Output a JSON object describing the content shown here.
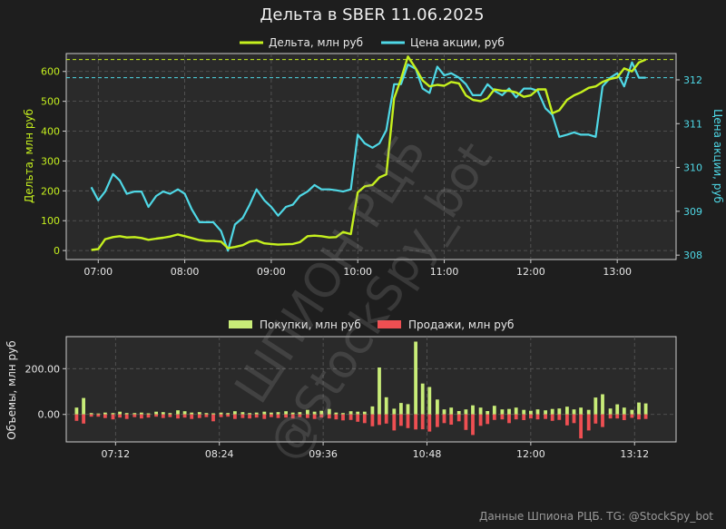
{
  "title": "Дельта в SBER 11.06.2025",
  "footer": "Данные Шпиона РЦБ. TG: @StockSpy_bot",
  "watermark": {
    "line1": "ШПИОН РЦБ",
    "line2": "@StockSpy_bot"
  },
  "colors": {
    "background": "#1e1e1e",
    "plot_bg": "#2a2a2a",
    "frame": "#cccccc",
    "delta": "#c5f01e",
    "price": "#4fd8e6",
    "buy": "#c8ec78",
    "sell": "#ee4f52",
    "text": "#e8e8e8",
    "footer": "#9a9a9a"
  },
  "chart_data": [
    {
      "type": "line",
      "legend": [
        "Дельта, млн руб",
        "Цена акции, руб"
      ],
      "legend_position": "top-center",
      "ylabel_left": "Дельта, млн руб",
      "ylabel_right": "Цена акции, руб",
      "grid": true,
      "x_unit": "hours",
      "xlim": [
        6.63,
        13.68
      ],
      "x_ticks": [
        7,
        8,
        9,
        10,
        11,
        12,
        13
      ],
      "x_tick_labels": [
        "07:00",
        "08:00",
        "09:00",
        "10:00",
        "11:00",
        "12:00",
        "13:00"
      ],
      "ylim_left": [
        -30,
        660
      ],
      "y_ticks_left": [
        0,
        100,
        200,
        300,
        400,
        500,
        600
      ],
      "ylim_right": [
        307.9,
        312.6
      ],
      "y_ticks_right": [
        308,
        309,
        310,
        311,
        312
      ],
      "ref_line_delta": 640,
      "ref_line_price": 312.05,
      "series": [
        {
          "name": "Дельта, млн руб",
          "axis": "left",
          "x": [
            6.92,
            7.0,
            7.08,
            7.17,
            7.25,
            7.33,
            7.42,
            7.5,
            7.58,
            7.67,
            7.75,
            7.83,
            7.92,
            8.0,
            8.08,
            8.17,
            8.25,
            8.33,
            8.42,
            8.5,
            8.58,
            8.67,
            8.75,
            8.83,
            8.92,
            9.0,
            9.08,
            9.17,
            9.25,
            9.33,
            9.42,
            9.5,
            9.58,
            9.67,
            9.75,
            9.83,
            9.92,
            10.0,
            10.08,
            10.17,
            10.25,
            10.33,
            10.42,
            10.5,
            10.58,
            10.67,
            10.75,
            10.83,
            10.92,
            11.0,
            11.08,
            11.17,
            11.25,
            11.33,
            11.42,
            11.5,
            11.58,
            11.67,
            11.75,
            11.83,
            11.92,
            12.0,
            12.08,
            12.17,
            12.25,
            12.33,
            12.42,
            12.5,
            12.58,
            12.67,
            12.75,
            12.83,
            12.92,
            13.0,
            13.08,
            13.17,
            13.25,
            13.33
          ],
          "y": [
            2,
            5,
            38,
            45,
            48,
            44,
            45,
            42,
            36,
            40,
            43,
            47,
            54,
            48,
            42,
            35,
            32,
            32,
            30,
            8,
            12,
            18,
            30,
            34,
            24,
            22,
            20,
            21,
            22,
            28,
            48,
            50,
            48,
            44,
            45,
            62,
            55,
            195,
            215,
            220,
            245,
            255,
            510,
            575,
            650,
            610,
            570,
            550,
            555,
            552,
            565,
            560,
            520,
            505,
            500,
            510,
            540,
            535,
            535,
            530,
            515,
            520,
            540,
            540,
            460,
            470,
            505,
            520,
            530,
            545,
            550,
            565,
            575,
            580,
            610,
            600,
            630,
            640
          ]
        },
        {
          "name": "Цена акции, руб",
          "axis": "right",
          "x": [
            6.92,
            7.0,
            7.08,
            7.17,
            7.25,
            7.33,
            7.42,
            7.5,
            7.58,
            7.67,
            7.75,
            7.83,
            7.92,
            8.0,
            8.08,
            8.17,
            8.25,
            8.33,
            8.42,
            8.5,
            8.58,
            8.67,
            8.75,
            8.83,
            8.92,
            9.0,
            9.08,
            9.17,
            9.25,
            9.33,
            9.42,
            9.5,
            9.58,
            9.67,
            9.75,
            9.83,
            9.92,
            10.0,
            10.08,
            10.17,
            10.25,
            10.33,
            10.42,
            10.5,
            10.58,
            10.67,
            10.75,
            10.83,
            10.92,
            11.0,
            11.08,
            11.17,
            11.25,
            11.33,
            11.42,
            11.5,
            11.58,
            11.67,
            11.75,
            11.83,
            11.92,
            12.0,
            12.08,
            12.17,
            12.25,
            12.33,
            12.42,
            12.5,
            12.58,
            12.67,
            12.75,
            12.83,
            12.92,
            13.0,
            13.08,
            13.17,
            13.25,
            13.33
          ],
          "y": [
            309.55,
            309.25,
            309.45,
            309.85,
            309.7,
            309.4,
            309.45,
            309.45,
            309.1,
            309.35,
            309.45,
            309.4,
            309.5,
            309.4,
            309.05,
            308.75,
            308.75,
            308.75,
            308.55,
            308.1,
            308.7,
            308.85,
            309.15,
            309.5,
            309.25,
            309.1,
            308.9,
            309.1,
            309.15,
            309.35,
            309.45,
            309.6,
            309.5,
            309.5,
            309.48,
            309.45,
            309.5,
            310.75,
            310.55,
            310.45,
            310.55,
            310.85,
            311.9,
            311.9,
            312.35,
            312.25,
            311.8,
            311.7,
            312.3,
            312.1,
            312.15,
            312.05,
            311.9,
            311.65,
            311.65,
            311.9,
            311.75,
            311.65,
            311.8,
            311.6,
            311.8,
            311.8,
            311.75,
            311.35,
            311.2,
            310.7,
            310.75,
            310.8,
            310.75,
            310.75,
            310.7,
            311.85,
            312.05,
            312.15,
            311.85,
            312.4,
            312.05,
            312.05
          ]
        }
      ]
    },
    {
      "type": "bar",
      "legend": [
        "Покупки, млн руб",
        "Продажи, млн руб"
      ],
      "legend_position": "top-center",
      "ylabel": "Объемы, млн руб",
      "grid": true,
      "x_unit": "hours",
      "xlim": [
        6.63,
        13.68
      ],
      "x_ticks": [
        7.2,
        8.4,
        9.6,
        10.8,
        12.0,
        13.2
      ],
      "x_tick_labels": [
        "07:12",
        "08:24",
        "09:36",
        "10:48",
        "12:00",
        "13:12"
      ],
      "ylim": [
        -120,
        340
      ],
      "y_ticks": [
        0,
        200
      ],
      "y_tick_labels": [
        "0.00",
        "200.00"
      ],
      "bar_width_hours": 0.04,
      "series": [
        {
          "name": "Покупки, млн руб",
          "x": [
            6.75,
            6.83,
            6.92,
            7.0,
            7.08,
            7.17,
            7.25,
            7.33,
            7.42,
            7.5,
            7.58,
            7.67,
            7.75,
            7.83,
            7.92,
            8.0,
            8.08,
            8.17,
            8.25,
            8.33,
            8.42,
            8.5,
            8.58,
            8.67,
            8.75,
            8.83,
            8.92,
            9.0,
            9.08,
            9.17,
            9.25,
            9.33,
            9.42,
            9.5,
            9.58,
            9.67,
            9.75,
            9.83,
            9.92,
            10.0,
            10.08,
            10.17,
            10.25,
            10.33,
            10.42,
            10.5,
            10.58,
            10.67,
            10.75,
            10.83,
            10.92,
            11.0,
            11.08,
            11.17,
            11.25,
            11.33,
            11.42,
            11.5,
            11.58,
            11.67,
            11.75,
            11.83,
            11.92,
            12.0,
            12.08,
            12.17,
            12.25,
            12.33,
            12.42,
            12.5,
            12.58,
            12.67,
            12.75,
            12.83,
            12.92,
            13.0,
            13.08,
            13.17,
            13.25,
            13.33
          ],
          "values": [
            30,
            72,
            6,
            4,
            8,
            6,
            12,
            6,
            6,
            8,
            5,
            12,
            10,
            6,
            18,
            14,
            8,
            10,
            6,
            5,
            8,
            6,
            14,
            10,
            6,
            8,
            12,
            8,
            10,
            14,
            8,
            10,
            20,
            12,
            16,
            24,
            8,
            6,
            14,
            12,
            12,
            35,
            205,
            75,
            25,
            50,
            45,
            318,
            135,
            120,
            65,
            22,
            30,
            15,
            22,
            40,
            30,
            15,
            38,
            22,
            24,
            30,
            20,
            16,
            22,
            18,
            24,
            26,
            34,
            22,
            30,
            20,
            74,
            88,
            26,
            44,
            30,
            20,
            52,
            48
          ]
        },
        {
          "name": "Продажи, млн руб",
          "x": [
            6.75,
            6.83,
            6.92,
            7.0,
            7.08,
            7.17,
            7.25,
            7.33,
            7.42,
            7.5,
            7.58,
            7.67,
            7.75,
            7.83,
            7.92,
            8.0,
            8.08,
            8.17,
            8.25,
            8.33,
            8.42,
            8.5,
            8.58,
            8.67,
            8.75,
            8.83,
            8.92,
            9.0,
            9.08,
            9.17,
            9.25,
            9.33,
            9.42,
            9.5,
            9.58,
            9.67,
            9.75,
            9.83,
            9.92,
            10.0,
            10.08,
            10.17,
            10.25,
            10.33,
            10.42,
            10.5,
            10.58,
            10.67,
            10.75,
            10.83,
            10.92,
            11.0,
            11.08,
            11.17,
            11.25,
            11.33,
            11.42,
            11.5,
            11.58,
            11.67,
            11.75,
            11.83,
            11.92,
            12.0,
            12.08,
            12.17,
            12.25,
            12.33,
            12.42,
            12.5,
            12.58,
            12.67,
            12.75,
            12.83,
            12.92,
            13.0,
            13.08,
            13.17,
            13.25,
            13.33
          ],
          "values": [
            -28,
            -40,
            -10,
            -10,
            -16,
            -22,
            -14,
            -20,
            -12,
            -18,
            -14,
            -10,
            -16,
            -12,
            -18,
            -14,
            -20,
            -16,
            -12,
            -30,
            -12,
            -10,
            -20,
            -16,
            -18,
            -14,
            -20,
            -12,
            -16,
            -14,
            -18,
            -12,
            -16,
            -20,
            -14,
            -18,
            -22,
            -26,
            -24,
            -32,
            -38,
            -52,
            -46,
            -40,
            -70,
            -50,
            -60,
            -66,
            -65,
            -75,
            -55,
            -38,
            -45,
            -30,
            -68,
            -90,
            -50,
            -42,
            -24,
            -22,
            -38,
            -22,
            -25,
            -18,
            -22,
            -20,
            -28,
            -24,
            -48,
            -38,
            -105,
            -70,
            -40,
            -55,
            -18,
            -18,
            -25,
            -15,
            -22,
            -20
          ]
        }
      ]
    }
  ]
}
